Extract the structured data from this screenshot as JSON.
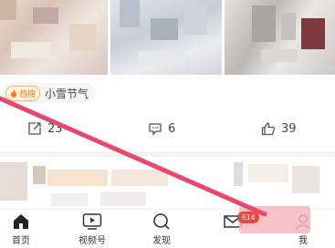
{
  "topic": {
    "hot_label": "热搜",
    "text": "小雪节气"
  },
  "actions": {
    "share_count": "23",
    "comment_count": "6",
    "like_count": "39"
  },
  "nav": {
    "home": "首页",
    "channel": "视频号",
    "discover": "发现",
    "me": "我",
    "message_badge": "814"
  },
  "colors": {
    "accent": "#ff7a00",
    "annotation": "#e8486a",
    "badge": "#e8483d"
  }
}
